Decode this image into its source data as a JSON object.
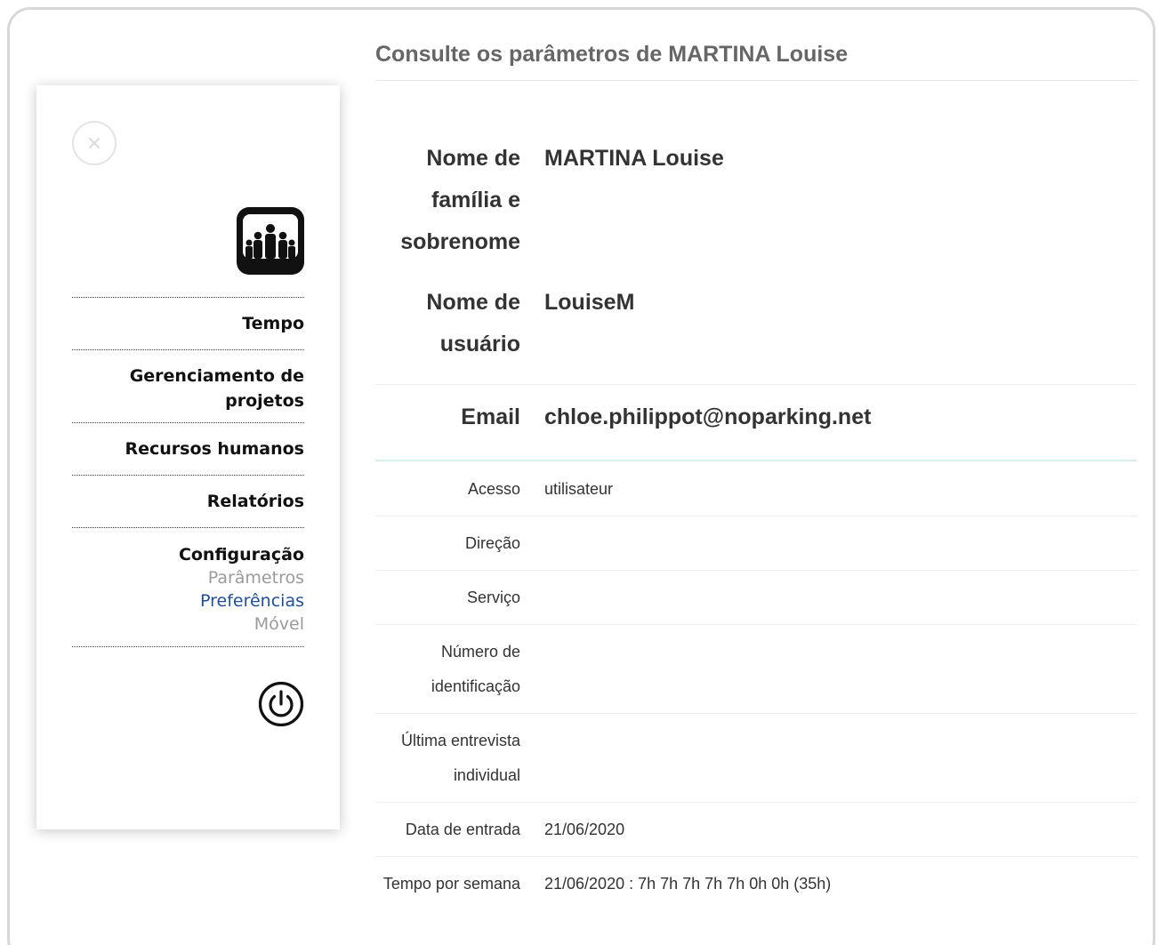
{
  "page": {
    "title": "Consulte os parâmetros de MARTINA Louise"
  },
  "sidebar": {
    "items": [
      {
        "label": "Tempo"
      },
      {
        "label": "Gerenciamento de projetos"
      },
      {
        "label": "Recursos humanos"
      },
      {
        "label": "Relatórios"
      },
      {
        "label": "Configuração"
      }
    ],
    "config_subitems": [
      {
        "label": "Parâmetros",
        "active": false
      },
      {
        "label": "Preferências",
        "active": true
      },
      {
        "label": "Móvel",
        "active": false
      }
    ],
    "active_color": "#1f4f9a",
    "icons": [
      "close-icon",
      "people-logo-icon",
      "power-icon"
    ]
  },
  "profile": {
    "full_name_label": "Nome de família e sobrenome",
    "full_name_value": "MARTINA Louise",
    "username_label": "Nome de usuário",
    "username_value": "LouiseM",
    "email_label": "Email",
    "email_value": "chloe.philippot@noparking.net",
    "details": [
      {
        "label": "Acesso",
        "value": "utilisateur"
      },
      {
        "label": "Direção",
        "value": ""
      },
      {
        "label": "Serviço",
        "value": ""
      },
      {
        "label": "Número de identificação",
        "value": ""
      },
      {
        "label": "Última entrevista individual",
        "value": ""
      },
      {
        "label": "Data de entrada",
        "value": "21/06/2020"
      },
      {
        "label": "Tempo por semana",
        "value": "21/06/2020 : 7h 7h 7h 7h 7h 0h 0h (35h)"
      }
    ]
  }
}
